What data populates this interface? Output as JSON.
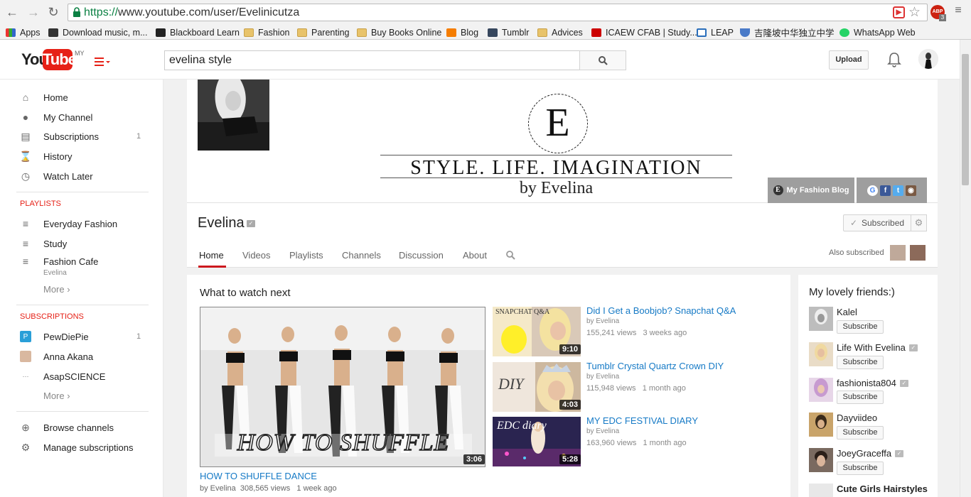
{
  "browser": {
    "url_scheme": "https://",
    "url_rest": "www.youtube.com/user/Evelinicutza",
    "bookmarks": [
      {
        "label": "Apps"
      },
      {
        "label": "Download music, m..."
      },
      {
        "label": "Blackboard Learn"
      },
      {
        "label": "Fashion"
      },
      {
        "label": "Parenting"
      },
      {
        "label": "Buy Books Online"
      },
      {
        "label": "Blog"
      },
      {
        "label": "Tumblr"
      },
      {
        "label": "Advices"
      },
      {
        "label": "ICAEW CFAB | Study..."
      },
      {
        "label": "LEAP"
      },
      {
        "label": "吉隆坡中华独立中学"
      },
      {
        "label": "WhatsApp Web"
      }
    ],
    "abp_badge": "ABP",
    "abp_count": "3"
  },
  "masthead": {
    "logo_you": "You",
    "logo_tube": "Tube",
    "logo_region": "MY",
    "search_value": "evelina style",
    "upload_label": "Upload"
  },
  "sidebar": {
    "main": [
      {
        "label": "Home",
        "icon": "home-icon"
      },
      {
        "label": "My Channel",
        "icon": "person-icon"
      },
      {
        "label": "Subscriptions",
        "icon": "subscriptions-icon",
        "count": "1"
      },
      {
        "label": "History",
        "icon": "hourglass-icon"
      },
      {
        "label": "Watch Later",
        "icon": "clock-icon"
      }
    ],
    "playlists_heading": "PLAYLISTS",
    "playlists": [
      {
        "label": "Everyday Fashion"
      },
      {
        "label": "Study"
      },
      {
        "label": "Fashion Cafe",
        "sub": "Evelina"
      }
    ],
    "playlists_more": "More ›",
    "subscriptions_heading": "SUBSCRIPTIONS",
    "subscriptions": [
      {
        "label": "PewDiePie",
        "count": "1"
      },
      {
        "label": "Anna Akana"
      },
      {
        "label": "AsapSCIENCE"
      }
    ],
    "subscriptions_more": "More ›",
    "bottom": [
      {
        "label": "Browse channels"
      },
      {
        "label": "Manage subscriptions"
      }
    ]
  },
  "channel": {
    "banner_initial": "E",
    "banner_title": "STYLE. LIFE. IMAGINATION",
    "banner_by": "by Evelina",
    "blog_link": "My Fashion Blog",
    "name": "Evelina",
    "subscribed_label": "Subscribed",
    "tabs": [
      "Home",
      "Videos",
      "Playlists",
      "Channels",
      "Discussion",
      "About"
    ],
    "also_subscribed": "Also subscribed"
  },
  "what_to_watch": {
    "heading": "What to watch next",
    "main_video": {
      "overlay_text": "HOW TO SHUFFLE",
      "duration": "3:06",
      "title": "HOW TO SHUFFLE DANCE",
      "channel": "by Evelina",
      "views": "308,565 views",
      "age": "1 week ago"
    },
    "side_videos": [
      {
        "title": "Did I Get a Boobjob? Snapchat Q&A",
        "channel": "by Evelina",
        "views": "155,241 views",
        "age": "3 weeks ago",
        "duration": "9:10",
        "thumb_text": "SNAPCHAT Q&A"
      },
      {
        "title": "Tumblr Crystal Quartz Crown DIY",
        "channel": "by Evelina",
        "views": "115,948 views",
        "age": "1 month ago",
        "duration": "4:03",
        "thumb_text": "DIY"
      },
      {
        "title": "MY EDC FESTIVAL DIARY",
        "channel": "by Evelina",
        "views": "163,960 views",
        "age": "1 month ago",
        "duration": "5:28",
        "thumb_text": "EDC diary"
      }
    ]
  },
  "friends": {
    "heading": "My lovely friends:)",
    "subscribe_label": "Subscribe",
    "items": [
      {
        "name": "Kalel",
        "verified": false
      },
      {
        "name": "Life With Evelina",
        "verified": true
      },
      {
        "name": "fashionista804",
        "verified": true
      },
      {
        "name": "Dayviideo",
        "verified": false
      },
      {
        "name": "JoeyGraceffa",
        "verified": true
      },
      {
        "name": "Cute Girls Hairstyles",
        "verified": false
      }
    ]
  },
  "colors": {
    "youtube_red": "#e62117",
    "link_blue": "#167ac6",
    "url_green": "#0b8043"
  }
}
